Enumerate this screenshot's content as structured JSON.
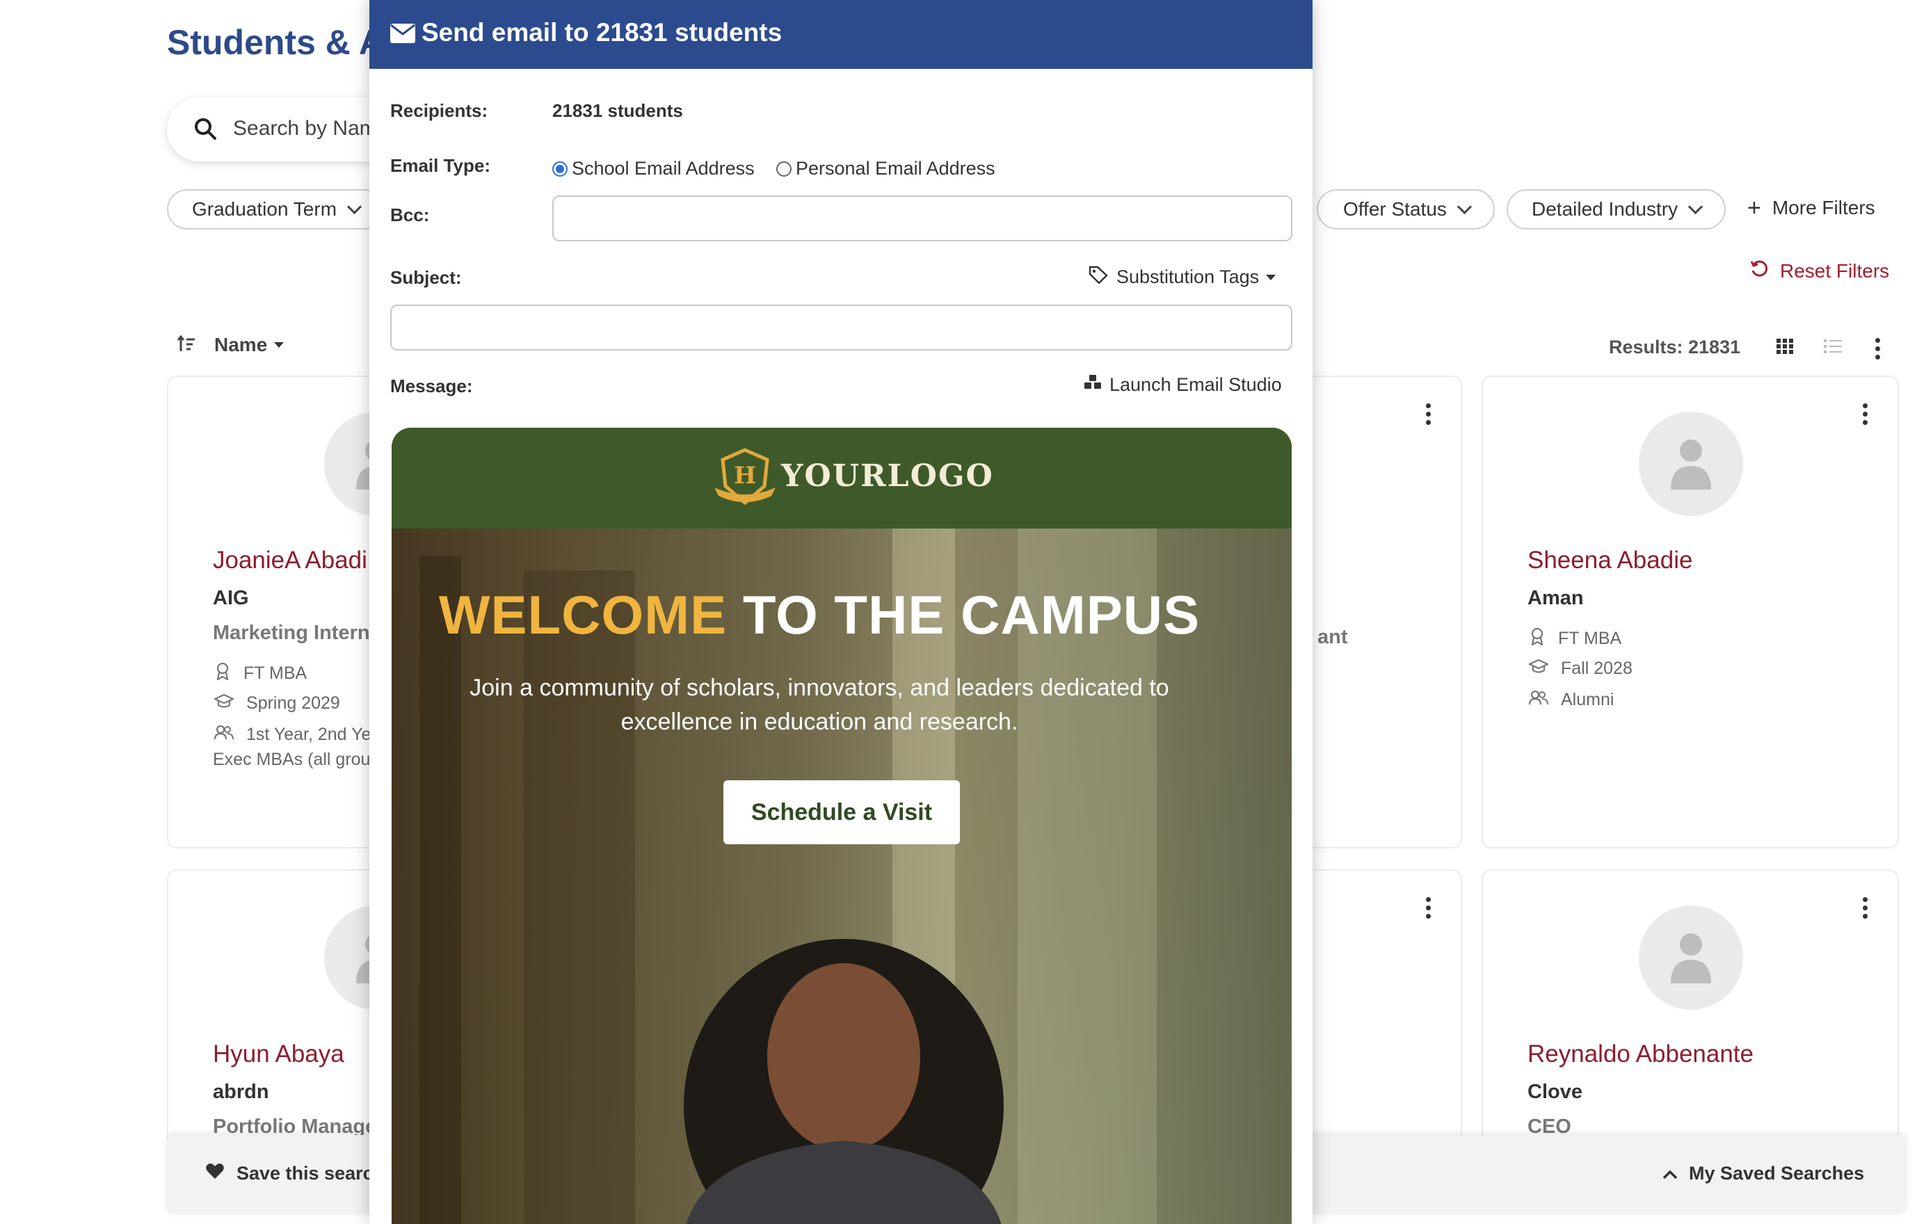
{
  "page": {
    "title": "Students & A",
    "search_placeholder": "Search by Nam",
    "filters": {
      "graduation_term": "Graduation Term",
      "offer_status": "Offer Status",
      "detailed_industry": "Detailed Industry",
      "more_filters": "More Filters",
      "reset_filters": "Reset Filters"
    },
    "sort_label": "Name",
    "results": "Results: 21831",
    "save_search": "Save this searc",
    "my_saved_searches": "My Saved Searches",
    "partial_role_text": "ant"
  },
  "cards": [
    {
      "name": "JoanieA Abadi",
      "company": "AIG",
      "role": "Marketing Intern",
      "program": "FT MBA",
      "term": "Spring 2029",
      "group": "1st Year, 2nd Yea",
      "group2": "Exec MBAs (all group"
    },
    {
      "name": "Sheena Abadie",
      "company": "Aman",
      "program": "FT MBA",
      "term": "Fall 2028",
      "group": "Alumni"
    },
    {
      "name": "Hyun Abaya",
      "company": "abrdn",
      "role": "Portfolio Manage"
    },
    {
      "name": "Reynaldo Abbenante",
      "company": "Clove",
      "role": "CEO"
    }
  ],
  "modal": {
    "title": "Send email to 21831 students",
    "recipients_label": "Recipients:",
    "recipients_value": "21831 students",
    "email_type_label": "Email Type:",
    "email_type_options": [
      "School Email Address",
      "Personal Email Address"
    ],
    "email_type_selected": "School Email Address",
    "bcc_label": "Bcc:",
    "bcc_value": "",
    "subject_label": "Subject:",
    "subject_value": "",
    "substitution_tags": "Substitution Tags",
    "message_label": "Message:",
    "launch_studio": "Launch Email Studio"
  },
  "email_preview": {
    "logo_text": "YOURLOGO",
    "heading_accent": "WELCOME",
    "heading_rest": "TO THE CAMPUS",
    "body": "Join a community of scholars, innovators, and leaders dedicated to excellence in education and research.",
    "cta": "Schedule a Visit"
  },
  "colors": {
    "primary_blue": "#2c4b8e",
    "name_red": "#8c1d2e",
    "reset_red": "#a41e2e",
    "email_green": "#3e5a2a",
    "accent_gold": "#f0b53f"
  }
}
